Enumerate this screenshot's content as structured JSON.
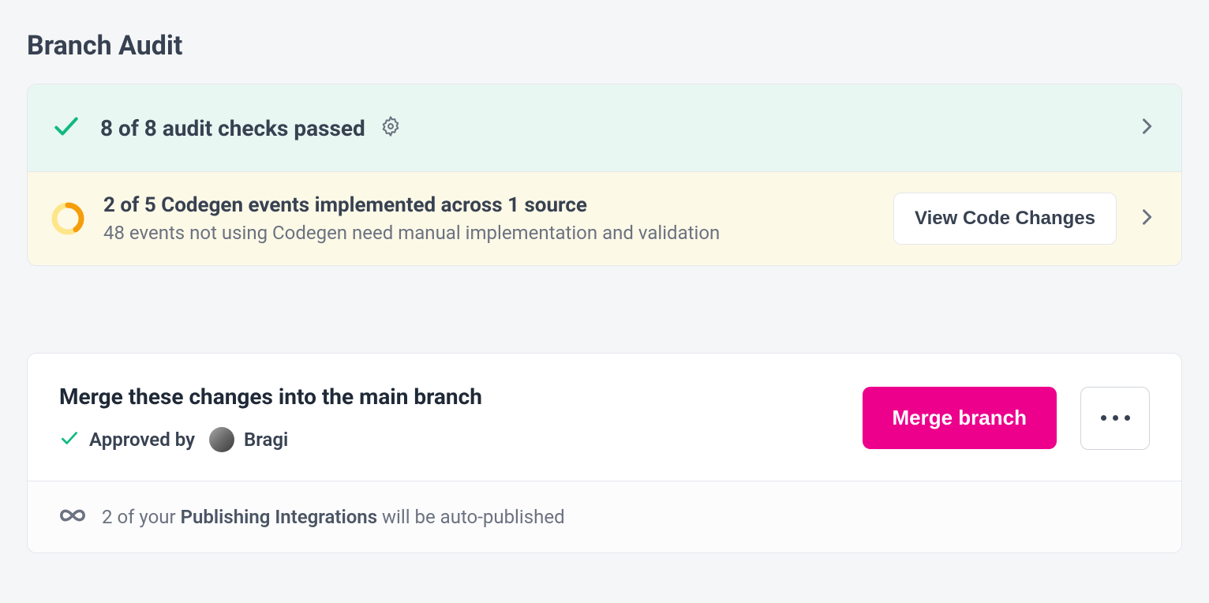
{
  "page_title": "Branch Audit",
  "audit": {
    "success_text": "8 of 8 audit checks passed",
    "codegen": {
      "title": "2 of 5 Codegen events implemented across 1 source",
      "subtitle": "48 events not using Codegen need manual implementation and validation",
      "button": "View Code Changes"
    }
  },
  "merge": {
    "title": "Merge these changes into the main branch",
    "approved_by_label": "Approved by",
    "approver": "Bragi",
    "button": "Merge branch"
  },
  "footer": {
    "prefix": "2 of your ",
    "bold": "Publishing Integrations",
    "suffix": " will be auto-published"
  }
}
